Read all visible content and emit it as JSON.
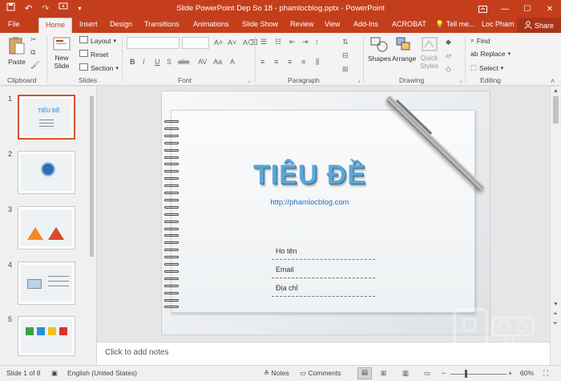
{
  "titlebar": {
    "title": "Slide PowerPoint Dep So 18 - phamlocblog.pptx - PowerPoint",
    "qat_icons": [
      "save-icon",
      "undo-icon",
      "redo-icon",
      "start-from-beginning-icon",
      "customize-icon"
    ],
    "window_icons": [
      "ribbon-display-icon",
      "minimize-icon",
      "maximize-icon",
      "close-icon"
    ]
  },
  "tabs": {
    "items": [
      "File",
      "Home",
      "Insert",
      "Design",
      "Transitions",
      "Animations",
      "Slide Show",
      "Review",
      "View",
      "Add-Ins",
      "ACROBAT"
    ],
    "active": "Home",
    "tell_me": "Tell me...",
    "user": "Loc Pham",
    "share": "Share"
  },
  "ribbon": {
    "clipboard": {
      "label": "Clipboard",
      "paste": "Paste"
    },
    "slides": {
      "label": "Slides",
      "new_slide": "New",
      "new_slide_2": "Slide",
      "layout": "Layout",
      "reset": "Reset",
      "section": "Section"
    },
    "font": {
      "label": "Font",
      "bold": "B",
      "italic": "I",
      "underline": "U",
      "strike": "S",
      "shadow": "abc"
    },
    "paragraph": {
      "label": "Paragraph"
    },
    "drawing": {
      "label": "Drawing",
      "shapes": "Shapes",
      "arrange": "Arrange",
      "quick_styles": "Quick",
      "quick_styles_2": "Styles"
    },
    "editing": {
      "label": "Editing",
      "find": "Find",
      "replace": "Replace",
      "select": "Select"
    }
  },
  "thumbnails": [
    {
      "num": "1",
      "title": "TIÊU ĐỀ"
    },
    {
      "num": "2"
    },
    {
      "num": "3"
    },
    {
      "num": "4"
    },
    {
      "num": "5"
    }
  ],
  "slide": {
    "title": "TIÊU ĐỀ",
    "url": "http://phamlocblog.com",
    "fields": [
      "Ho tên",
      "Email",
      "Địa chỉ"
    ]
  },
  "notes": {
    "placeholder": "Click to add notes"
  },
  "status": {
    "slide_of": "Slide 1 of 8",
    "language": "English (United States)",
    "notes": "Notes",
    "comments": "Comments",
    "zoom": "60%"
  },
  "watermark": {
    "text": "blog"
  },
  "colors": {
    "accent": "#c43e1c",
    "title_blue": "#5aa7d8"
  }
}
